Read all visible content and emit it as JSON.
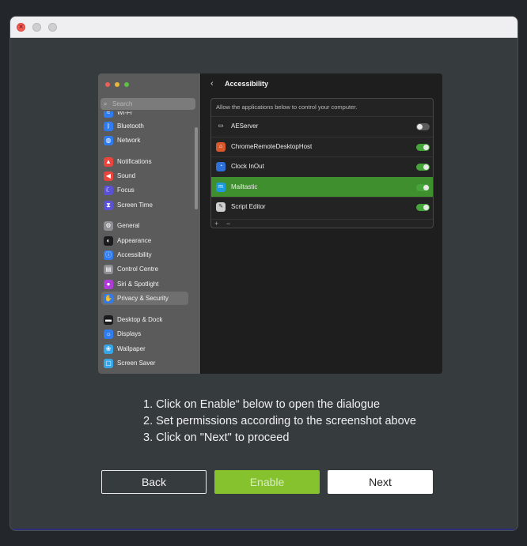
{
  "screenshot": {
    "sidebar": {
      "search_placeholder": "Search",
      "items": [
        {
          "label": "Wi-Fi",
          "icon": "wifi-icon",
          "color": "#2f7cf0"
        },
        {
          "label": "Bluetooth",
          "icon": "bluetooth-icon",
          "color": "#2f7cf0"
        },
        {
          "label": "Network",
          "icon": "globe-icon",
          "color": "#2f7cf0"
        },
        {
          "label": "Notifications",
          "icon": "bell-icon",
          "color": "#e8453c"
        },
        {
          "label": "Sound",
          "icon": "speaker-icon",
          "color": "#e8453c"
        },
        {
          "label": "Focus",
          "icon": "moon-icon",
          "color": "#5b52d6"
        },
        {
          "label": "Screen Time",
          "icon": "hourglass-icon",
          "color": "#5b52d6"
        },
        {
          "label": "General",
          "icon": "gear-icon",
          "color": "#8e8e93"
        },
        {
          "label": "Appearance",
          "icon": "appearance-icon",
          "color": "#1c1c1e"
        },
        {
          "label": "Accessibility",
          "icon": "accessibility-icon",
          "color": "#2f7cf0"
        },
        {
          "label": "Control Centre",
          "icon": "control-centre-icon",
          "color": "#8e8e93"
        },
        {
          "label": "Siri & Spotlight",
          "icon": "siri-icon",
          "color": "#b03cd8"
        },
        {
          "label": "Privacy & Security",
          "icon": "hand-icon",
          "color": "#2f7cf0"
        },
        {
          "label": "Desktop & Dock",
          "icon": "dock-icon",
          "color": "#1c1c1e"
        },
        {
          "label": "Displays",
          "icon": "sun-icon",
          "color": "#2f7cf0"
        },
        {
          "label": "Wallpaper",
          "icon": "wallpaper-icon",
          "color": "#37a6e8"
        },
        {
          "label": "Screen Saver",
          "icon": "screensaver-icon",
          "color": "#37a6e8"
        }
      ],
      "selected": "Privacy & Security"
    },
    "main": {
      "title": "Accessibility",
      "description": "Allow the applications below to control your computer.",
      "apps": [
        {
          "name": "AEServer",
          "enabled": false,
          "icon": "terminal-icon"
        },
        {
          "name": "ChromeRemoteDesktopHost",
          "enabled": true,
          "icon": "house-icon"
        },
        {
          "name": "Clock InOut",
          "enabled": true,
          "icon": "clock-app-icon"
        },
        {
          "name": "Mailtastic",
          "enabled": true,
          "icon": "mailtastic-icon",
          "highlighted": true
        },
        {
          "name": "Script Editor",
          "enabled": true,
          "icon": "script-editor-icon"
        }
      ],
      "add": "+",
      "remove": "−"
    }
  },
  "instructions": {
    "step1": "1. Click on Enable“ below to open the dialogue",
    "step2": "2. Set permissions according to the screenshot above",
    "step3": "3. Click on \"Next\" to proceed"
  },
  "buttons": {
    "back": "Back",
    "enable": "Enable",
    "next": "Next"
  },
  "colors": {
    "accent_green": "#86c22d",
    "highlight_green": "#3f8f2e",
    "toggle_on": "#46a43a"
  }
}
